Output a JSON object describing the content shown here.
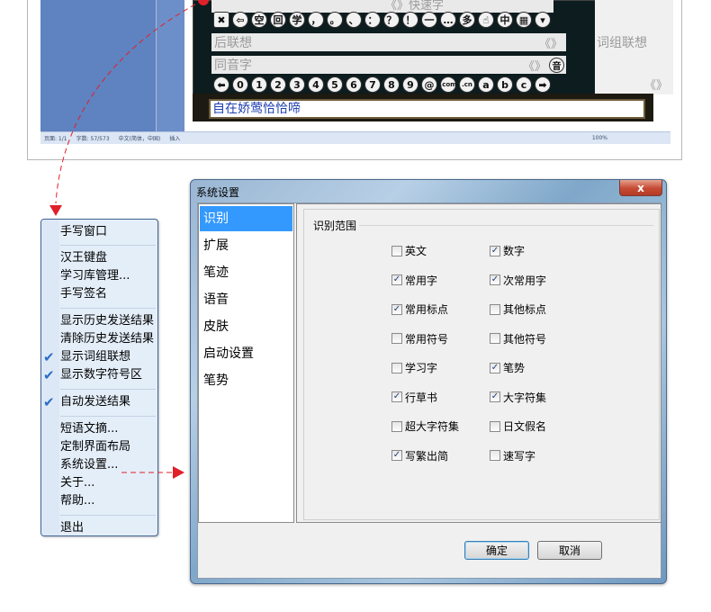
{
  "ime": {
    "top_hint": "《》快速字",
    "row1_keys": [
      "✖",
      "⇦",
      "空",
      "回",
      "学",
      "，",
      "。",
      "、",
      "：",
      "？",
      "！",
      "一",
      "…",
      "多",
      "☝",
      "中",
      "▦",
      "▾"
    ],
    "assoc_label": "后联想",
    "assoc_arrows": "《》",
    "phrase_label": "词组联想",
    "homophone_label": "同音字",
    "homophone_arrows": "《》",
    "homophone_btn": "音",
    "row2_keys": [
      "⬅",
      "0",
      "1",
      "2",
      "3",
      "4",
      "5",
      "6",
      "7",
      "8",
      "9",
      "@",
      ".com",
      ".cn",
      "a",
      "b",
      "c",
      "➡"
    ],
    "side_arrows": "《》",
    "input_text": "自在娇莺恰恰啼",
    "status_left": "页面: 1/1",
    "status_words": "字数: 57/573",
    "status_lang": "中文(简体，中国)",
    "status_mode": "插入",
    "status_zoom": "100%"
  },
  "menu": {
    "items": [
      {
        "label": "手写窗口",
        "checked": false
      },
      {
        "label": "汉王键盘",
        "checked": false
      },
      {
        "label": "学习库管理...",
        "checked": false
      },
      {
        "label": "手写签名",
        "checked": false
      },
      {
        "label": "显示历史发送结果",
        "checked": false
      },
      {
        "label": "清除历史发送结果",
        "checked": false
      },
      {
        "label": "显示词组联想",
        "checked": true
      },
      {
        "label": "显示数字符号区",
        "checked": true
      },
      {
        "label": "自动发送结果",
        "checked": true
      },
      {
        "label": "短语文摘...",
        "checked": false
      },
      {
        "label": "定制界面布局",
        "checked": false
      },
      {
        "label": "系统设置...",
        "checked": false
      },
      {
        "label": "关于...",
        "checked": false
      },
      {
        "label": "帮助...",
        "checked": false
      },
      {
        "label": "退出",
        "checked": false
      }
    ]
  },
  "dialog": {
    "title": "系统设置",
    "close_label": "x",
    "categories": [
      "识别",
      "扩展",
      "笔迹",
      "语音",
      "皮肤",
      "启动设置",
      "笔势"
    ],
    "selected_category": "识别",
    "group_title": "识别范围",
    "options": [
      {
        "label": "英文",
        "checked": false
      },
      {
        "label": "数字",
        "checked": true
      },
      {
        "label": "常用字",
        "checked": true
      },
      {
        "label": "次常用字",
        "checked": true
      },
      {
        "label": "常用标点",
        "checked": true
      },
      {
        "label": "其他标点",
        "checked": false
      },
      {
        "label": "常用符号",
        "checked": false
      },
      {
        "label": "其他符号",
        "checked": false
      },
      {
        "label": "学习字",
        "checked": false
      },
      {
        "label": "笔势",
        "checked": true
      },
      {
        "label": "行草书",
        "checked": true
      },
      {
        "label": "大字符集",
        "checked": true
      },
      {
        "label": "超大字符集",
        "checked": false
      },
      {
        "label": "日文假名",
        "checked": false
      },
      {
        "label": "写繁出简",
        "checked": true
      },
      {
        "label": "速写字",
        "checked": false
      }
    ],
    "ok_label": "确定",
    "cancel_label": "取消"
  },
  "colors": {
    "menu_bg": "#e4eef9",
    "selected_bg": "#3399ff",
    "check": "#2a6ec6",
    "arrow": "#e0202a"
  }
}
